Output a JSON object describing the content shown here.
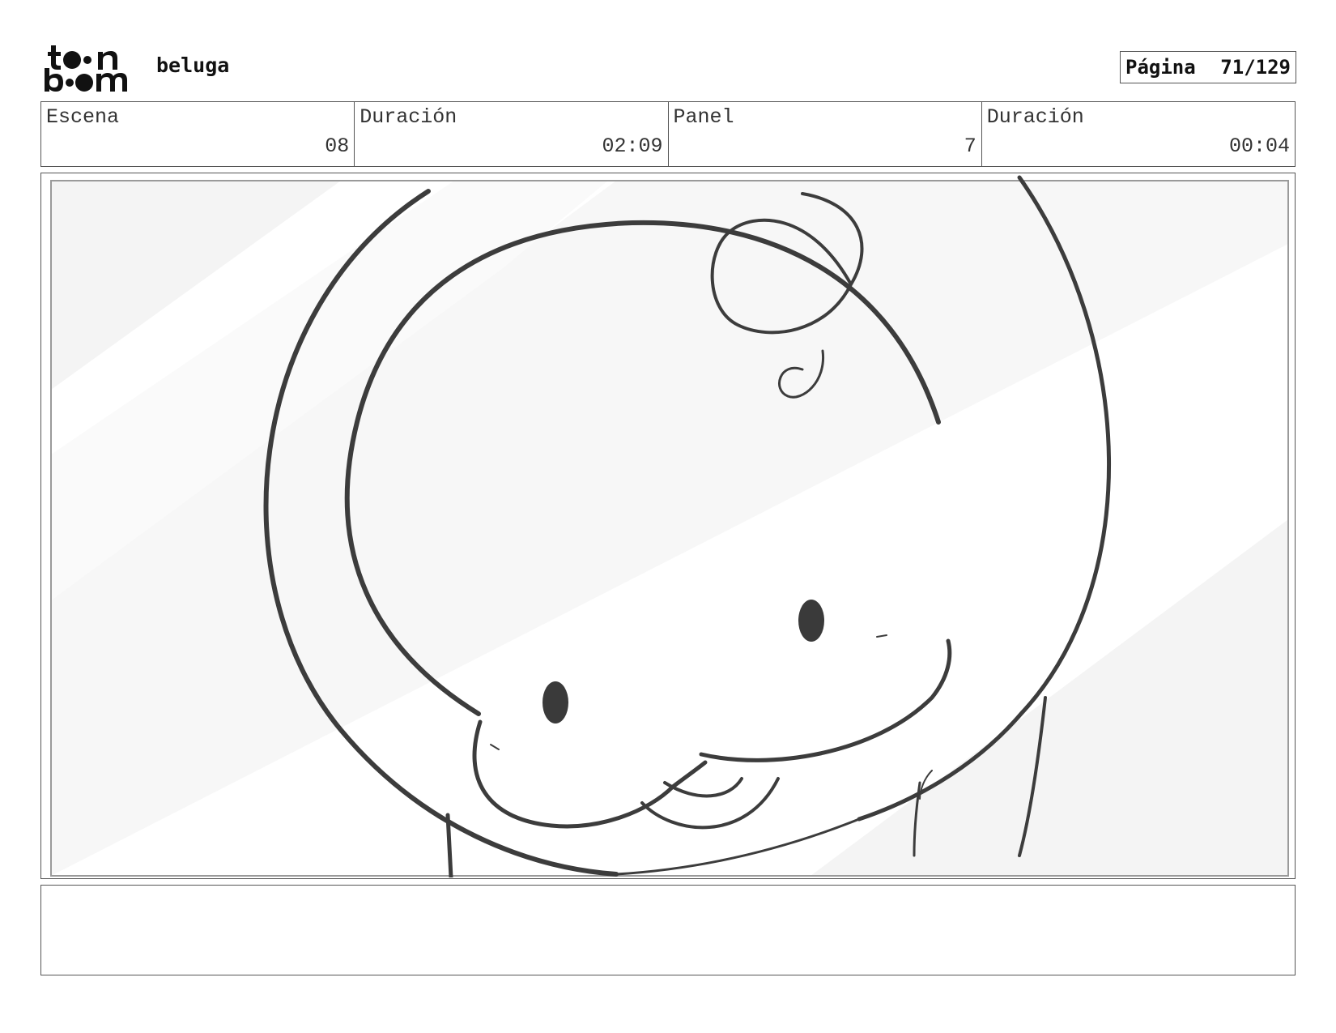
{
  "header": {
    "logo_text_top": "toon",
    "logo_text_bottom": "boom",
    "project_title": "beluga",
    "page_label": "Página",
    "page_number": "71/129"
  },
  "info": {
    "scene_label": "Escena",
    "scene_value": "08",
    "scene_duration_label": "Duración",
    "scene_duration_value": "02:09",
    "panel_label": "Panel",
    "panel_value": "7",
    "panel_duration_label": "Duración",
    "panel_duration_value": "00:04"
  },
  "panel_image": {
    "subject": "beluga-sketch-icon"
  },
  "notes": {
    "text": ""
  }
}
